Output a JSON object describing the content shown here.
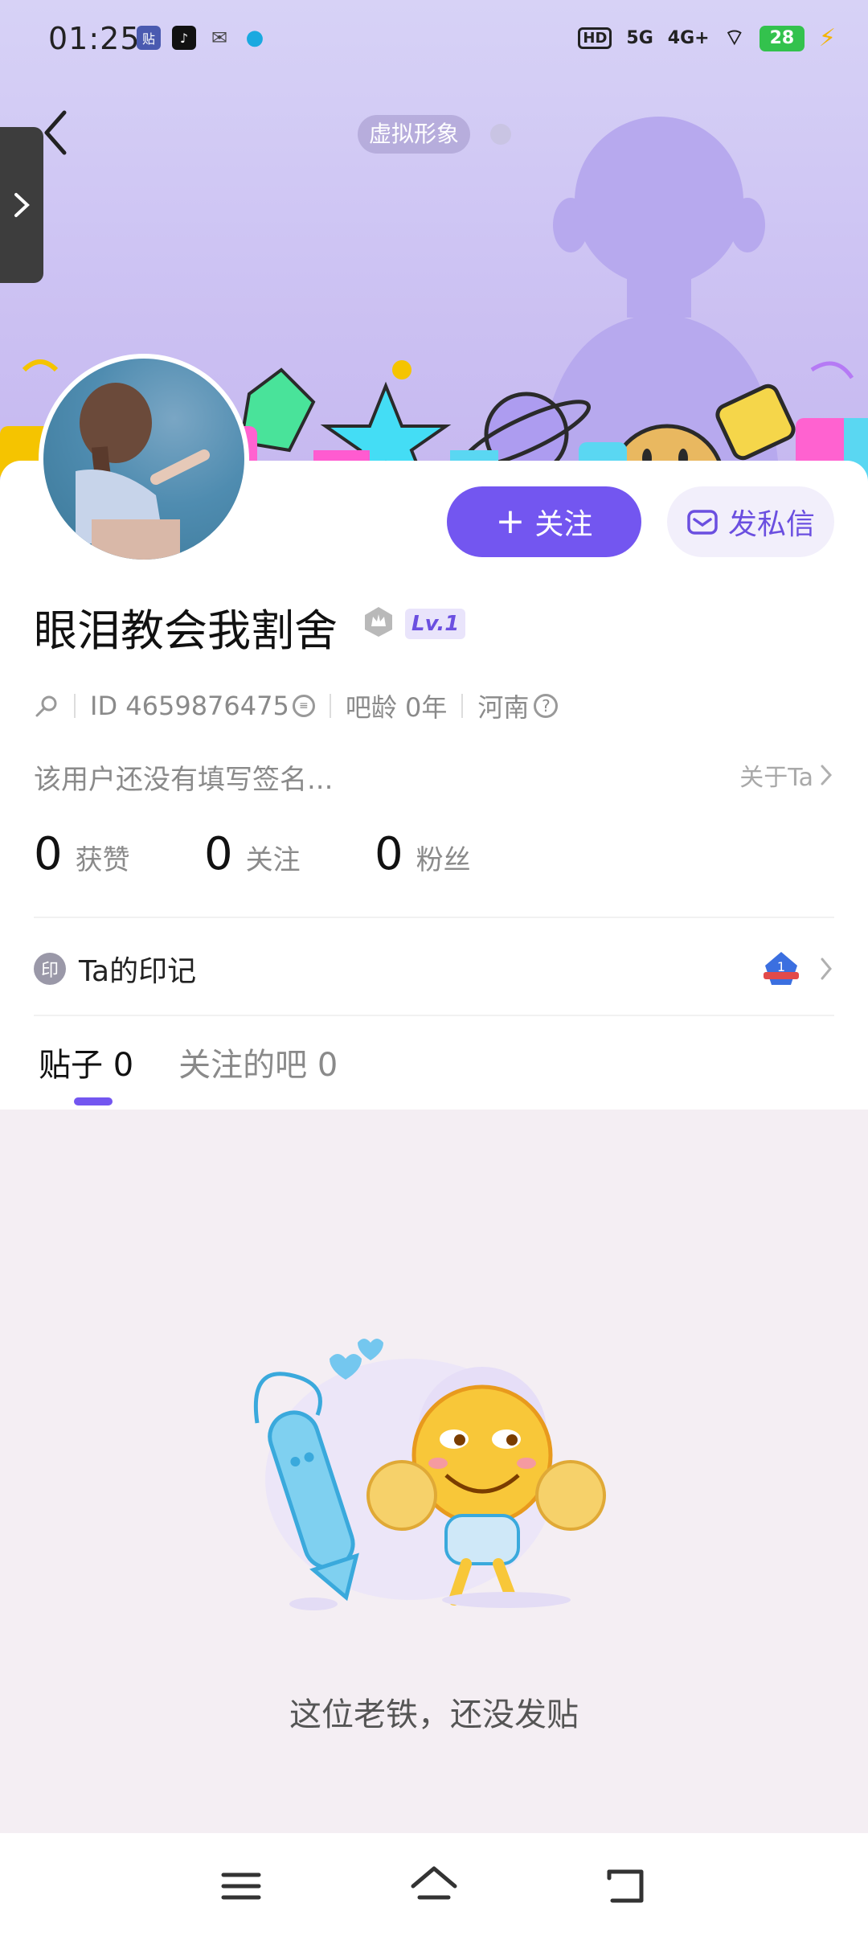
{
  "status": {
    "time": "01:25",
    "network": "5G",
    "network2": "4G+",
    "hd": "HD",
    "battery": "28"
  },
  "header": {
    "virtual_tag": "虚拟形象"
  },
  "profile": {
    "username": "眼泪教会我割舍",
    "level": "Lv.1",
    "id_text": "ID 4659876475",
    "bar_age": "吧龄 0年",
    "location": "河南",
    "signature": "该用户还没有填写签名...",
    "about": "关于Ta"
  },
  "actions": {
    "follow_label": "关注",
    "message_label": "发私信"
  },
  "stats": [
    {
      "num": "0",
      "label": "获赞"
    },
    {
      "num": "0",
      "label": "关注"
    },
    {
      "num": "0",
      "label": "粉丝"
    }
  ],
  "mark": {
    "icon_text": "印",
    "label": "Ta的印记"
  },
  "tabs": [
    {
      "label": "贴子 0",
      "active": true
    },
    {
      "label": "关注的吧 0",
      "active": false
    }
  ],
  "empty": {
    "message": "这位老铁，还没发贴"
  },
  "colors": {
    "accent": "#7356f0",
    "banner": "#cdc3f3"
  }
}
